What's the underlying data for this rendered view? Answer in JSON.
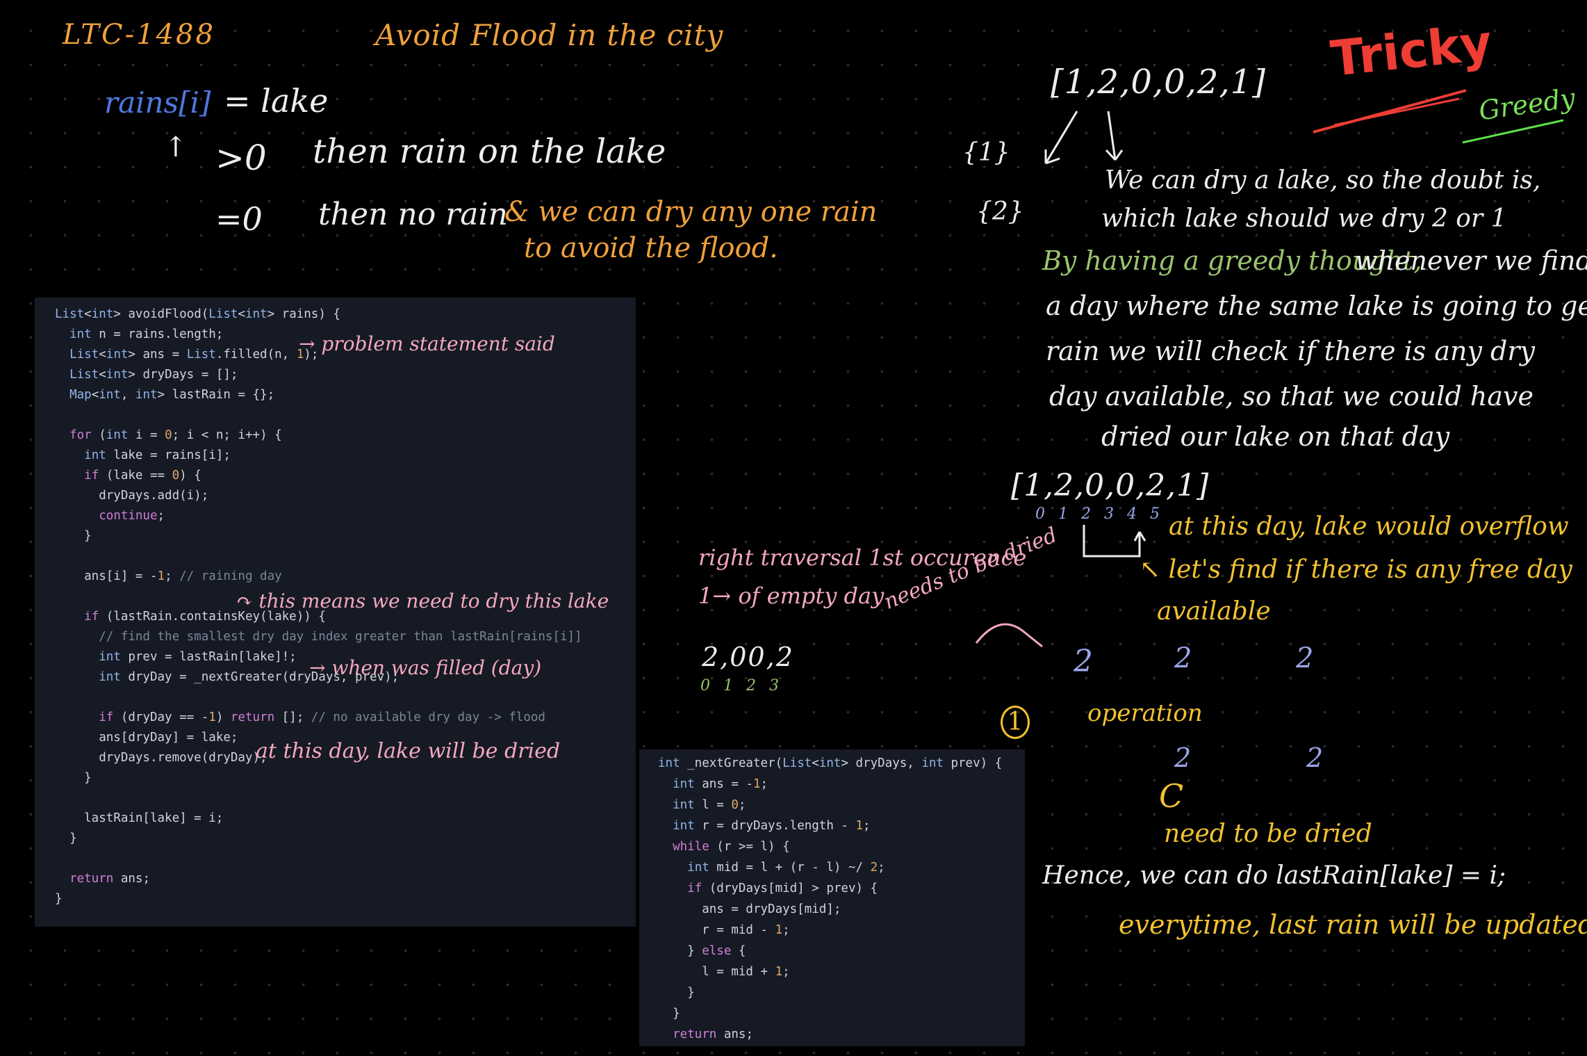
{
  "header": {
    "problem_id": "LTC-1488",
    "title": "Avoid Flood in the city"
  },
  "badges": {
    "tricky": "Tricky",
    "greedy": "Greedy"
  },
  "rules": {
    "line1_var": "rains[i]",
    "line1_eq": "= lake",
    "line2_arrow": "↑",
    "line2_cond": ">0",
    "line2_text": "then rain on the lake",
    "line3_cond": "=0",
    "line3_text": "then no rain",
    "line3_note": "& we can dry any one rain",
    "line4_note": "to avoid the flood."
  },
  "main_code": {
    "lines": [
      "List<int> avoidFlood(List<int> rains) {",
      "  int n = rains.length;",
      "  List<int> ans = List.filled(n, 1);",
      "  List<int> dryDays = [];",
      "  Map<int, int> lastRain = {};",
      "",
      "  for (int i = 0; i < n; i++) {",
      "    int lake = rains[i];",
      "    if (lake == 0) {",
      "      dryDays.add(i);",
      "      continue;",
      "    }",
      "",
      "    ans[i] = -1; // raining day",
      "",
      "    if (lastRain.containsKey(lake)) {",
      "      // find the smallest dry day index greater than lastRain[rains[i]]",
      "      int prev = lastRain[lake]!;",
      "      int dryDay = _nextGreater(dryDays, prev);",
      "",
      "      if (dryDay == -1) return []; // no available dry day -> flood",
      "      ans[dryDay] = lake;",
      "      dryDays.remove(dryDay);",
      "    }",
      "",
      "    lastRain[lake] = i;",
      "  }",
      "",
      "  return ans;",
      "}"
    ]
  },
  "helper_code": {
    "lines": [
      "int _nextGreater(List<int> dryDays, int prev) {",
      "  int ans = -1;",
      "  int l = 0;",
      "  int r = dryDays.length - 1;",
      "  while (r >= l) {",
      "    int mid = l + (r - l) ~/ 2;",
      "    if (dryDays[mid] > prev) {",
      "      ans = dryDays[mid];",
      "      r = mid - 1;",
      "    } else {",
      "      l = mid + 1;",
      "    }",
      "  }",
      "  return ans;"
    ]
  },
  "code_annotations": {
    "problem_statement": "→ problem statement said",
    "need_to_dry": "↷ this means we need to dry this lake",
    "when_filled": "→ when was filled (day)",
    "at_this_day": "at this day, lake will be dried"
  },
  "right_notes": {
    "array1": "[1,2,0,0,2,1]",
    "brace1": "{1}",
    "brace2": "{2}",
    "doubt1": "We can dry a lake, so the doubt is,",
    "doubt2": "which lake should we dry 2 or 1",
    "greedy_prefix": "By having a greedy thought,",
    "greedy_rest1": "whenever we find",
    "p2": "a day where the same lake is going to get",
    "p3": "rain we will check if there is any dry",
    "p4": "day available, so that we could have",
    "p5": "dried our lake on that day",
    "array2": "[1,2,0,0,2,1]",
    "indices2": "0 1 2 3 4 5",
    "overflow": "at this day, lake would overflow",
    "find1": "↖ let's find if there is any free day",
    "find2": "available",
    "ones_a": "2",
    "ones_b": "2",
    "ones_c": "2",
    "circled_one": "1",
    "operation": "operation",
    "twos_a": "2",
    "twos_b": "2",
    "curl": "C",
    "need_dried": "need to be dried",
    "hence": "Hence, we can do lastRain[lake] = i;",
    "everytime": "everytime, last rain will be updated"
  },
  "middle_notes": {
    "traversal": "right traversal 1st occurence",
    "arrow_empty": "1→ of empty day",
    "needs_dried": "needs to be dried",
    "arr": "2,00,2",
    "arr_idx": "0 1 2 3"
  }
}
